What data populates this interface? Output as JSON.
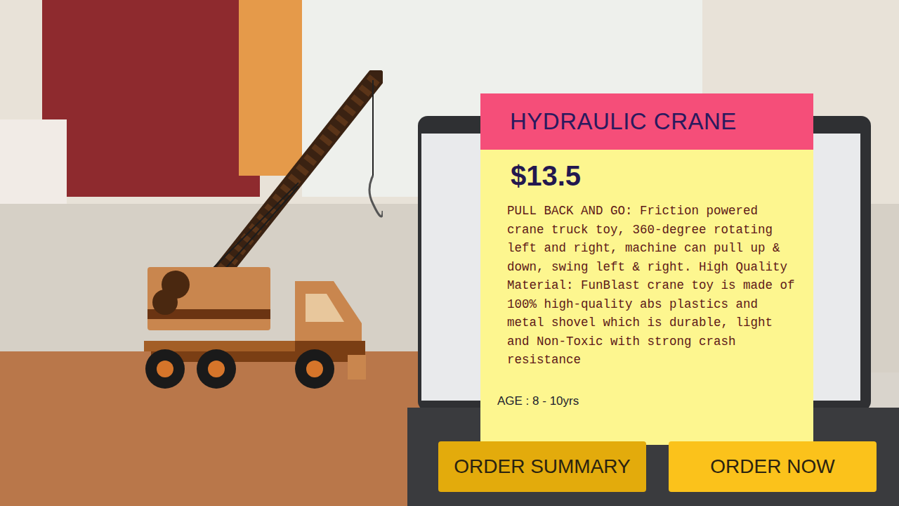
{
  "product": {
    "title": "HYDRAULIC CRANE",
    "price": "$13.5",
    "description": "PULL BACK AND GO: Friction powered crane truck toy, 360-degree rotating left and right, machine can pull up & down, swing left & right. High Quality Material: FunBlast crane toy is made of 100% high-quality abs plastics and metal shovel which is durable, light and Non-Toxic with strong crash resistance",
    "age": "AGE : 8 - 10yrs"
  },
  "buttons": [
    {
      "label": "ORDER SUMMARY",
      "pressed": true
    },
    {
      "label": "ORDER NOW",
      "pressed": false
    }
  ]
}
